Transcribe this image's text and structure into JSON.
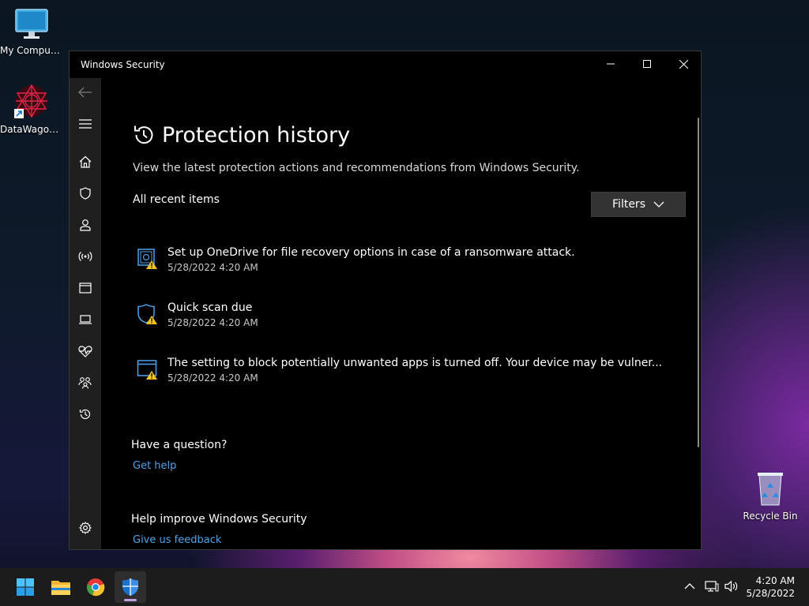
{
  "desktop": {
    "icons": [
      {
        "label": "My Computer"
      },
      {
        "label": "DataWagon..."
      },
      {
        "label": "Recycle Bin"
      }
    ]
  },
  "window": {
    "title": "Windows Security",
    "page": {
      "title": "Protection history",
      "subtitle": "View the latest protection actions and recommendations from Windows Security.",
      "section_label": "All recent items",
      "filters_label": "Filters",
      "items": [
        {
          "title": "Set up OneDrive for file recovery options in case of a ransomware attack.",
          "timestamp": "5/28/2022 4:20 AM",
          "icon": "onedrive-warning-icon"
        },
        {
          "title": "Quick scan due",
          "timestamp": "5/28/2022 4:20 AM",
          "icon": "shield-warning-icon"
        },
        {
          "title": "The setting to block potentially unwanted apps is turned off. Your device may be vulner...",
          "timestamp": "5/28/2022 4:20 AM",
          "icon": "app-browser-warning-icon"
        }
      ],
      "question": {
        "heading": "Have a question?",
        "link": "Get help"
      },
      "improve": {
        "heading": "Help improve Windows Security",
        "link": "Give us feedback"
      }
    },
    "sidebar": [
      "back-icon",
      "menu-icon",
      "home-icon",
      "shield-icon",
      "account-icon",
      "network-icon",
      "app-browser-icon",
      "device-security-icon",
      "health-icon",
      "family-icon",
      "history-icon",
      "settings-icon"
    ]
  },
  "taskbar": {
    "apps": [
      "start-icon",
      "file-explorer-icon",
      "chrome-icon",
      "windows-security-icon"
    ],
    "clock": {
      "time": "4:20 AM",
      "date": "5/28/2022"
    }
  },
  "colors": {
    "accent": "#4fa3e8",
    "warning": "#f5c518",
    "sidebar": "#1f1f1f"
  }
}
